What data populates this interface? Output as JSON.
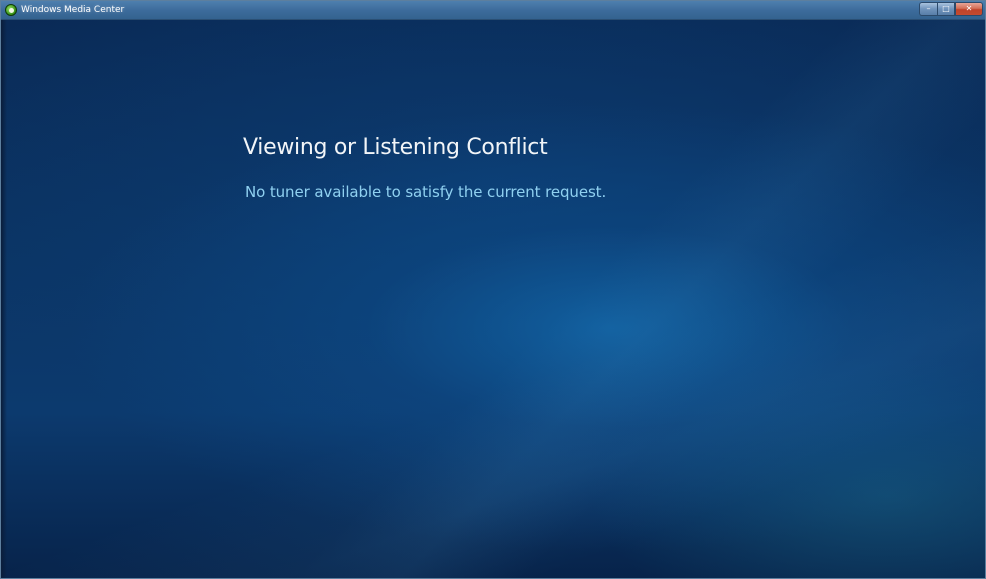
{
  "window": {
    "title": "Windows Media Center",
    "app_icon": "windows-media-center-icon",
    "caption_buttons": {
      "minimize": "–",
      "maximize": "□",
      "close": "✕"
    }
  },
  "dialog": {
    "title": "Viewing or Listening Conflict",
    "message": "No tuner available to satisfy the current request."
  },
  "colors": {
    "background_dark": "#0a2a56",
    "background_glow": "#1266a8",
    "title_text": "#f2f5f8",
    "message_text": "#8fd0f0"
  }
}
